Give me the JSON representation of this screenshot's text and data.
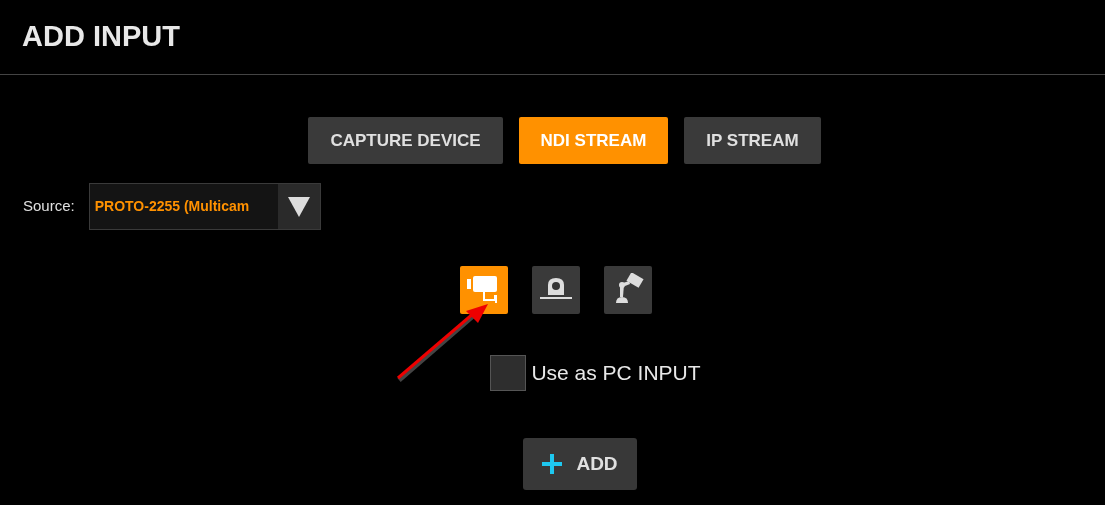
{
  "title": "ADD INPUT",
  "tabs": [
    {
      "label": "CAPTURE DEVICE",
      "selected": false
    },
    {
      "label": "NDI STREAM",
      "selected": true
    },
    {
      "label": "IP STREAM",
      "selected": false
    }
  ],
  "source": {
    "label": "Source:",
    "value": "PROTO-2255 (Multicam"
  },
  "device_types": [
    {
      "kind": "camera",
      "selected": true
    },
    {
      "kind": "ptz",
      "selected": false
    },
    {
      "kind": "robotic",
      "selected": false
    }
  ],
  "pc_input": {
    "label": "Use as PC INPUT",
    "checked": false
  },
  "add_button": {
    "label": "ADD"
  }
}
